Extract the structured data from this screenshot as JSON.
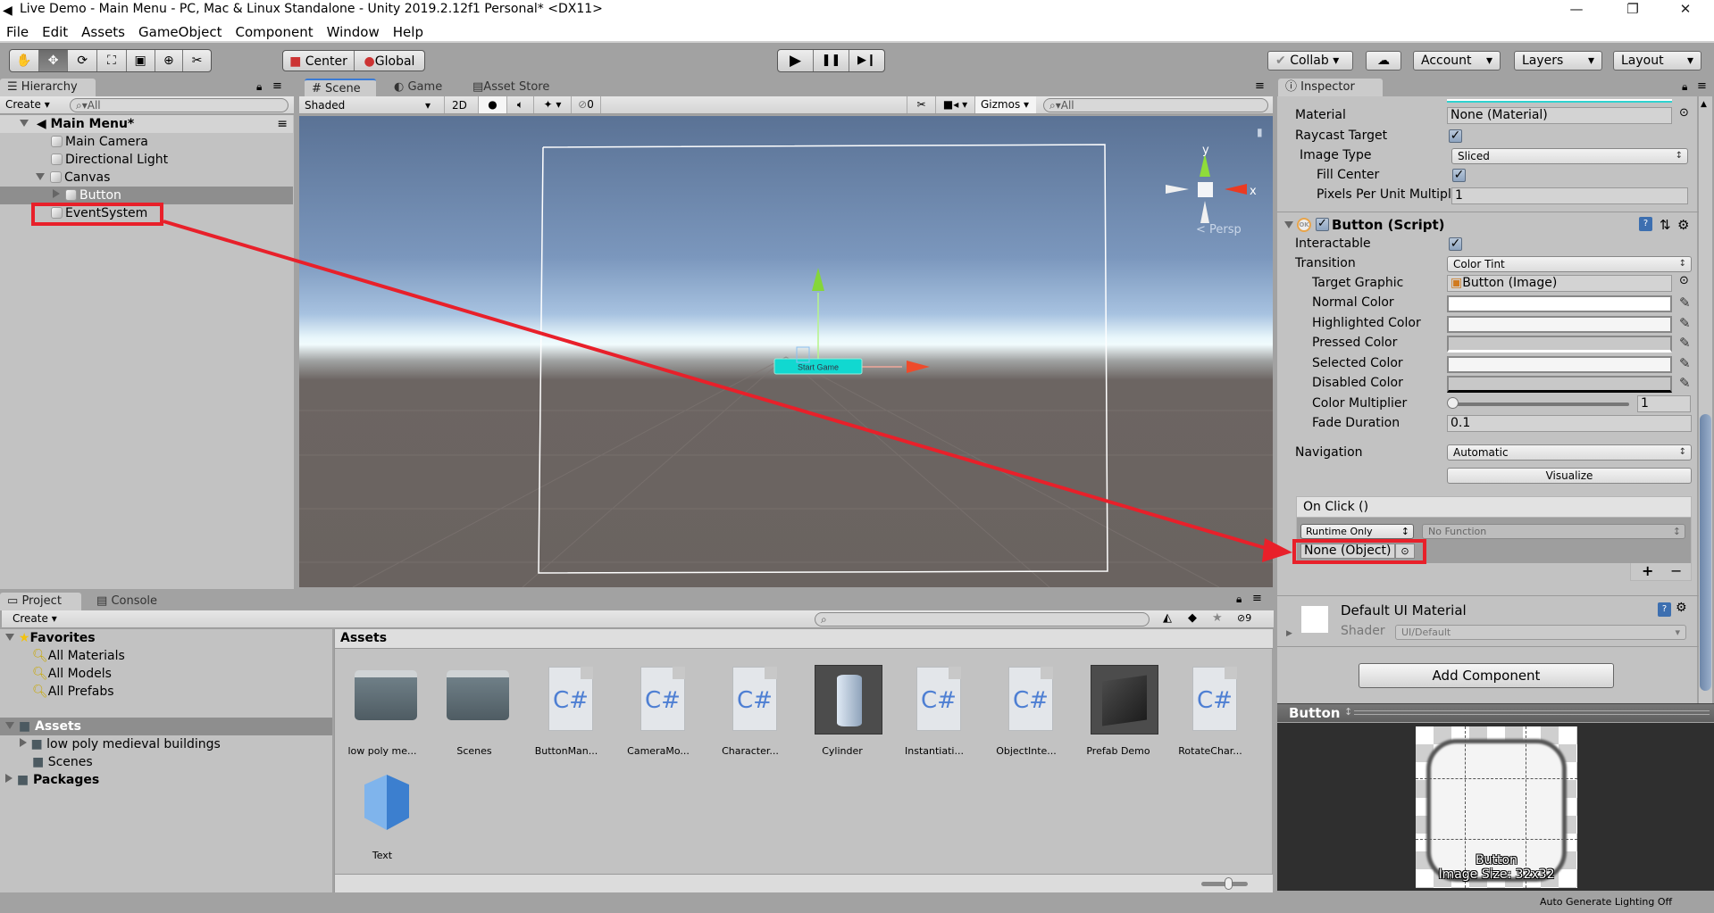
{
  "window": {
    "title": "Live Demo - Main Menu - PC, Mac & Linux Standalone - Unity 2019.2.12f1 Personal* <DX11>",
    "controls": [
      "—",
      "❐",
      "✕"
    ]
  },
  "menu": [
    "File",
    "Edit",
    "Assets",
    "GameObject",
    "Component",
    "Window",
    "Help"
  ],
  "toolbar": {
    "tools": [
      {
        "name": "hand-tool",
        "glyph": "✋"
      },
      {
        "name": "move-tool",
        "glyph": "✥"
      },
      {
        "name": "rotate-tool",
        "glyph": "⟳"
      },
      {
        "name": "scale-tool",
        "glyph": "⛶"
      },
      {
        "name": "rect-tool",
        "glyph": "▣"
      },
      {
        "name": "transform-tool",
        "glyph": "⊕"
      },
      {
        "name": "custom-tool",
        "glyph": "✂"
      }
    ],
    "pivot": "Center",
    "space": "Global",
    "play": "▶",
    "pause": "❚❚",
    "step": "▶❙",
    "collab": "Collab",
    "account": "Account",
    "layers": "Layers",
    "layout": "Layout"
  },
  "hierarchy": {
    "tab": "Hierarchy",
    "create": "Create",
    "search_placeholder": "All",
    "scene": "Main Menu*",
    "items": [
      {
        "label": "Main Camera",
        "depth": 1
      },
      {
        "label": "Directional Light",
        "depth": 1
      },
      {
        "label": "Canvas",
        "depth": 1,
        "expanded": true
      },
      {
        "label": "Button",
        "depth": 2,
        "selected": true
      },
      {
        "label": "EventSystem",
        "depth": 1,
        "highlighted": true
      }
    ]
  },
  "scene": {
    "tabs": [
      "Scene",
      "Game",
      "Asset Store"
    ],
    "shading": "Shaded",
    "mode_2d": "2D",
    "hidden_count": "0",
    "gizmos": "Gizmos",
    "search_placeholder": "All",
    "persp": "Persp",
    "axis_y": "y",
    "axis_x": "x",
    "button_text": "Start Game"
  },
  "inspector": {
    "tab": "Inspector",
    "image_rows": [
      {
        "label": "Material",
        "value": "None (Material)"
      },
      {
        "label": "Raycast Target",
        "checked": true
      },
      {
        "label": "Image Type",
        "value": "Sliced"
      },
      {
        "label": "Fill Center",
        "checked": true
      },
      {
        "label": "Pixels Per Unit Multipli",
        "value": "1"
      }
    ],
    "button_component": {
      "title": "Button (Script)",
      "enabled": true,
      "interactable_label": "Interactable",
      "interactable": true,
      "transition_label": "Transition",
      "transition": "Color Tint",
      "target_graphic_label": "Target Graphic",
      "target_graphic": "Button (Image)",
      "colors": [
        {
          "label": "Normal Color",
          "hex": "#FFFFFF"
        },
        {
          "label": "Highlighted Color",
          "hex": "#F5F5F5"
        },
        {
          "label": "Pressed Color",
          "hex": "#C8C8C8"
        },
        {
          "label": "Selected Color",
          "hex": "#F5F5F5"
        },
        {
          "label": "Disabled Color",
          "hex": "#C8C8C8"
        }
      ],
      "color_multiplier_label": "Color Multiplier",
      "color_multiplier": "1",
      "fade_duration_label": "Fade Duration",
      "fade_duration": "0.1",
      "navigation_label": "Navigation",
      "navigation": "Automatic",
      "visualize": "Visualize",
      "onclick_title": "On Click ()",
      "runtime": "Runtime Only",
      "function": "No Function",
      "object": "None (Object)",
      "add": "+",
      "remove": "−"
    },
    "material": {
      "name": "Default UI Material",
      "shader_label": "Shader",
      "shader": "UI/Default"
    },
    "add_component": "Add Component",
    "preview": {
      "title": "Button",
      "caption_name": "Button",
      "caption_size": "Image Size: 32x32"
    }
  },
  "project": {
    "tabs": [
      "Project",
      "Console"
    ],
    "create": "Create",
    "favorites": {
      "label": "Favorites",
      "items": [
        "All Materials",
        "All Models",
        "All Prefabs"
      ]
    },
    "assets_label": "Assets",
    "asset_children": [
      "low poly medieval buildings",
      "Scenes"
    ],
    "packages_label": "Packages",
    "breadcrumb": "Assets",
    "hidden_count": "9",
    "zoom_slider": 0.6,
    "assets": [
      {
        "label": "low poly me...",
        "type": "folder"
      },
      {
        "label": "Scenes",
        "type": "folder"
      },
      {
        "label": "ButtonMan...",
        "type": "script"
      },
      {
        "label": "CameraMo...",
        "type": "script"
      },
      {
        "label": "Character...",
        "type": "script"
      },
      {
        "label": "Cylinder",
        "type": "model"
      },
      {
        "label": "Instantiati...",
        "type": "script"
      },
      {
        "label": "ObjectInte...",
        "type": "script"
      },
      {
        "label": "Prefab Demo",
        "type": "prefab"
      },
      {
        "label": "RotateChar...",
        "type": "script"
      },
      {
        "label": "Text",
        "type": "prefab-blue"
      }
    ]
  },
  "status": {
    "lighting": "Auto Generate Lighting Off"
  },
  "annotation_color": "#E8202A"
}
